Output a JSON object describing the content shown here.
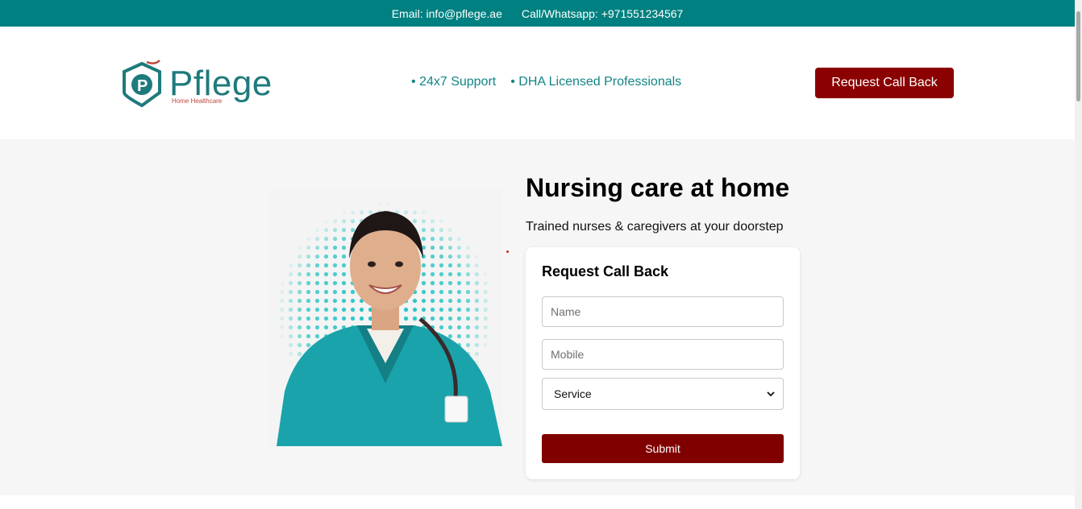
{
  "topbar": {
    "email": "Email: info@pflege.ae",
    "phone": "Call/Whatsapp: +971551234567"
  },
  "header": {
    "logo_word": "Pflege",
    "logo_sub": "Home Healthcare",
    "features": [
      "• 24x7 Support",
      "• DHA Licensed Professionals"
    ],
    "cta_label": "Request Call Back"
  },
  "hero": {
    "title": "Nursing care at home",
    "subtitle": "Trained nurses & caregivers at your doorstep",
    "image_icon": "nurse-photo"
  },
  "form": {
    "title": "Request Call Back",
    "name_placeholder": "Name",
    "mobile_placeholder": "Mobile",
    "service_selected": "Service",
    "submit_label": "Submit"
  },
  "colors": {
    "teal": "#008080",
    "accent_teal": "#138585",
    "brand_red": "#8b0000",
    "submit_red": "#800000",
    "hero_bg": "#f6f6f6"
  }
}
